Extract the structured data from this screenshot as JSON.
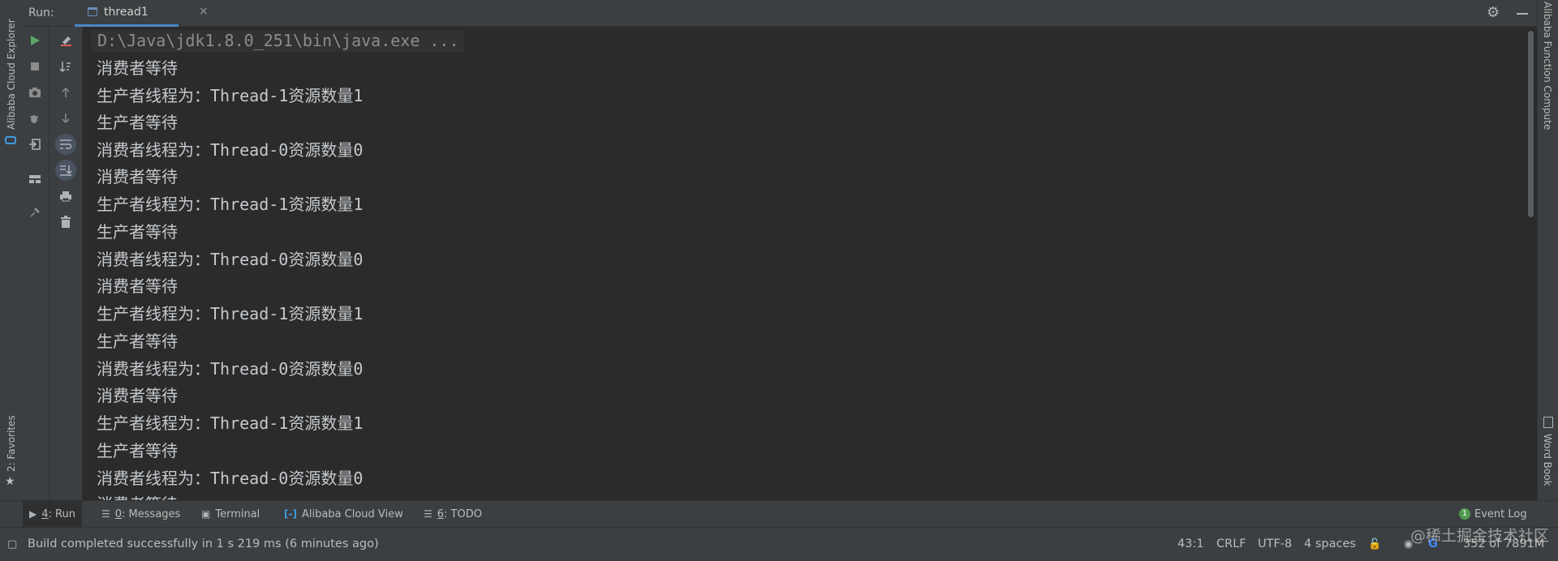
{
  "left_strip": {
    "top_label": "Alibaba Cloud Explorer",
    "bottom_label": "2: Favorites"
  },
  "right_strip": {
    "top_label": "Alibaba Function Compute",
    "bottom_label": "Word Book"
  },
  "run_header": {
    "run_label": "Run:",
    "tab_label": "thread1",
    "tab_close": "×"
  },
  "console": {
    "command": "D:\\Java\\jdk1.8.0_251\\bin\\java.exe ...",
    "lines": [
      "消费者等待",
      "生产者线程为：Thread-1资源数量1",
      "生产者等待",
      "消费者线程为：Thread-0资源数量0",
      "消费者等待",
      "生产者线程为：Thread-1资源数量1",
      "生产者等待",
      "消费者线程为：Thread-0资源数量0",
      "消费者等待",
      "生产者线程为：Thread-1资源数量1",
      "生产者等待",
      "消费者线程为：Thread-0资源数量0",
      "消费者等待",
      "生产者线程为：Thread-1资源数量1",
      "生产者等待",
      "消费者线程为：Thread-0资源数量0",
      "消费者等待"
    ]
  },
  "tool_tabs": [
    {
      "num": "4",
      "label": ": Run",
      "icon": "play-icon"
    },
    {
      "num": "0",
      "label": ": Messages",
      "icon": "messages-icon"
    },
    {
      "num": "",
      "label": "Terminal",
      "icon": "terminal-icon"
    },
    {
      "num": "",
      "label": "Alibaba Cloud View",
      "icon": "alibaba-cloud-icon"
    },
    {
      "num": "6",
      "label": ": TODO",
      "icon": "todo-icon"
    }
  ],
  "event_log": {
    "badge": "1",
    "label": "Event Log"
  },
  "status_bar": {
    "message": "Build completed successfully in 1 s 219 ms (6 minutes ago)",
    "position": "43:1",
    "line_separator": "CRLF",
    "encoding": "UTF-8",
    "indent": "4 spaces",
    "memory": "352 of 7891M"
  },
  "watermark": "@稀土掘金技术社区",
  "colors": {
    "background": "#2b2b2b",
    "panel": "#3c3f41",
    "accent": "#4a88c7",
    "run_green": "#59a869",
    "stop_gray": "#8c8c8c"
  }
}
